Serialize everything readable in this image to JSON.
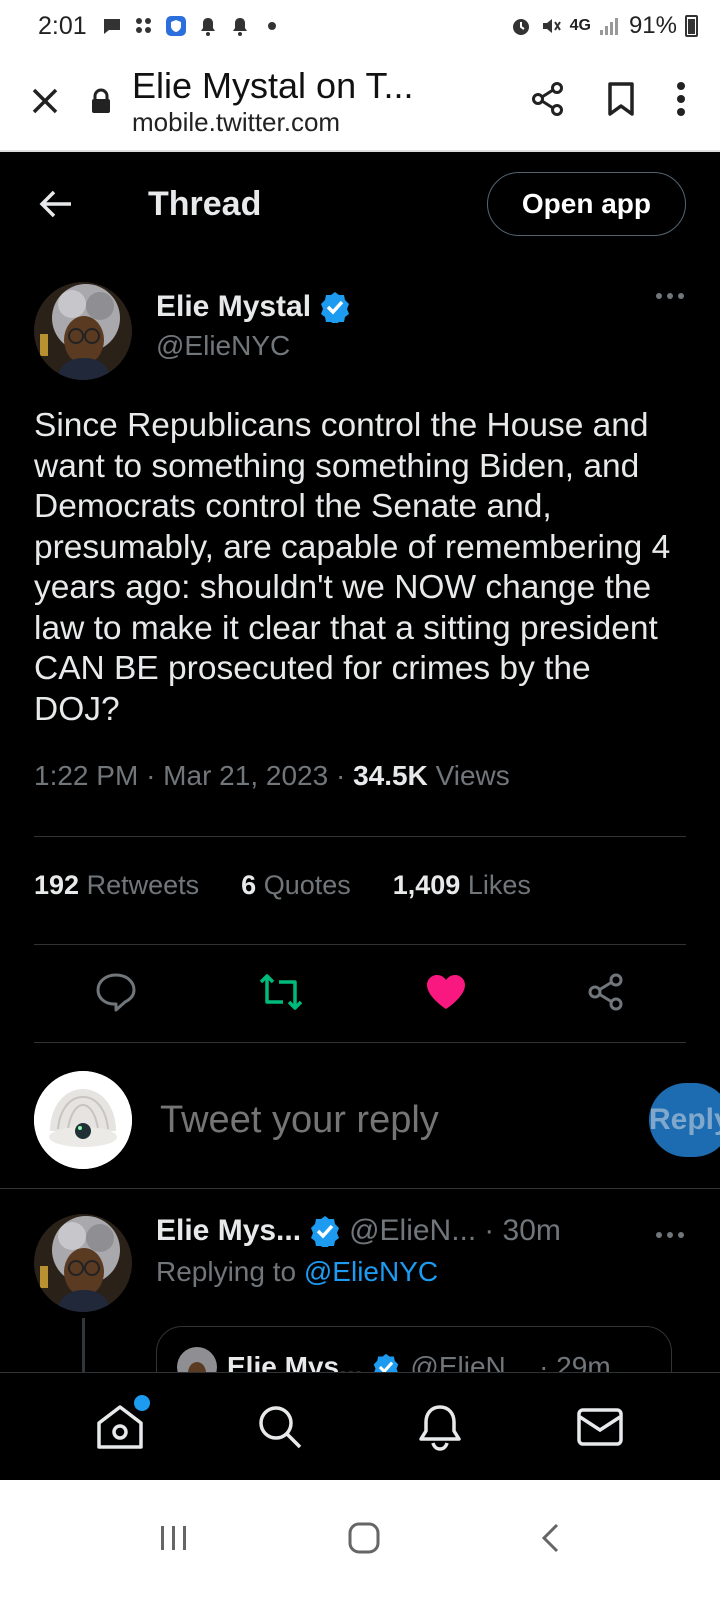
{
  "status_bar": {
    "time": "2:01",
    "battery": "91%",
    "network": "4G"
  },
  "browser": {
    "page_title": "Elie Mystal on T...",
    "host": "mobile.twitter.com"
  },
  "header": {
    "title": "Thread",
    "open_app_label": "Open app"
  },
  "tweet": {
    "author_name": "Elie Mystal",
    "author_handle": "@ElieNYC",
    "text": "Since Republicans control the House and want to something something Biden, and Democrats control the Senate and, presumably, are capable of remembering 4 years ago: shouldn't we NOW change the law to make it clear that a sitting president CAN BE prosecuted for crimes by the DOJ?",
    "time": "1:22 PM",
    "date": "Mar 21, 2023",
    "views_count": "34.5K",
    "views_label": "Views",
    "retweets_count": "192",
    "retweets_label": "Retweets",
    "quotes_count": "6",
    "quotes_label": "Quotes",
    "likes_count": "1,409",
    "likes_label": "Likes",
    "liked": true
  },
  "reply_box": {
    "placeholder": "Tweet your reply",
    "button_label": "Reply"
  },
  "next_tweet": {
    "author_name": "Elie Mys...",
    "author_handle": "@ElieN...",
    "age": "· 30m",
    "replying_prefix": "Replying to",
    "replying_to": "@ElieNYC",
    "quote_author": "Elie Mys...",
    "quote_handle": "@ElieN...",
    "quote_age": "· 29m"
  },
  "colors": {
    "accent": "#1d9bf0",
    "like": "#f91880",
    "retweet": "#00ba7c",
    "background": "#000000"
  }
}
